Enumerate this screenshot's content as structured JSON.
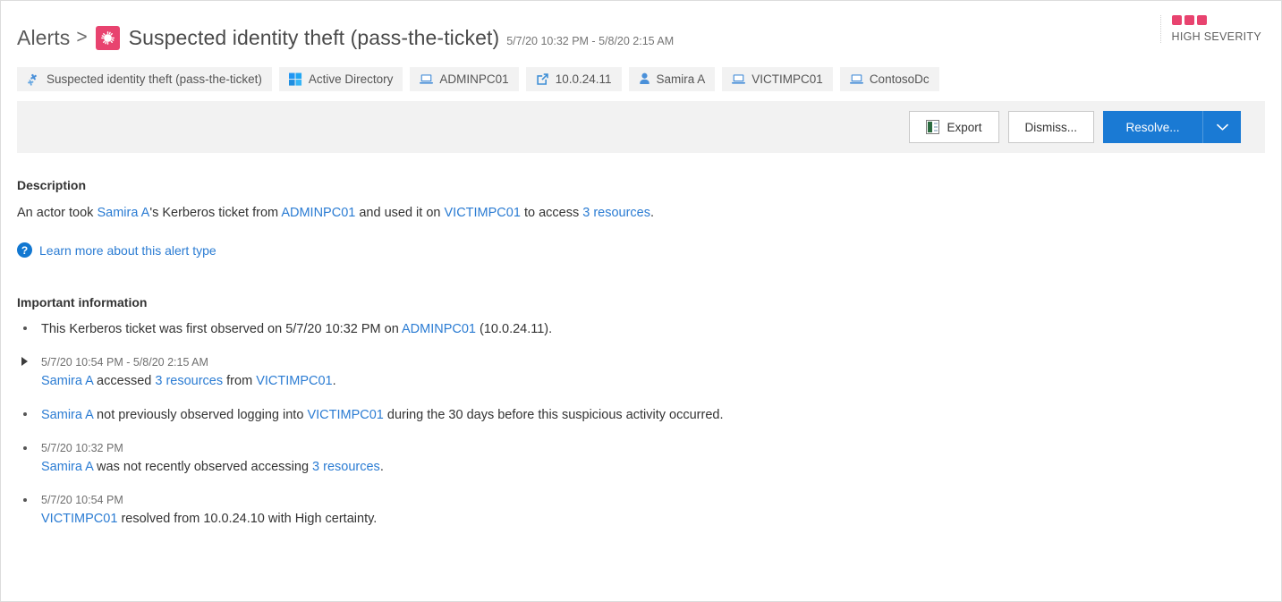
{
  "header": {
    "breadcrumb_root": "Alerts",
    "breadcrumb_separator": ">",
    "alert_icon": "alert-starburst-icon",
    "title": "Suspected identity theft (pass-the-ticket)",
    "time_range": "5/7/20 10:32 PM - 5/8/20 2:15 AM",
    "severity_label": "HIGH SEVERITY",
    "severity_color": "#e8436f",
    "severity_bars": 3
  },
  "chips": [
    {
      "label": "Suspected identity theft (pass-the-ticket)",
      "icon": "alert-puzzle-icon"
    },
    {
      "label": "Active Directory",
      "icon": "windows-logo-icon"
    },
    {
      "label": "ADMINPC01",
      "icon": "computer-icon"
    },
    {
      "label": "10.0.24.11",
      "icon": "external-link-icon"
    },
    {
      "label": "Samira A",
      "icon": "person-icon"
    },
    {
      "label": "VICTIMPC01",
      "icon": "computer-icon"
    },
    {
      "label": "ContosoDc",
      "icon": "computer-icon"
    }
  ],
  "toolbar": {
    "export_label": "Export",
    "export_icon": "excel-export-icon",
    "dismiss_label": "Dismiss...",
    "resolve_label": "Resolve...",
    "resolve_caret_icon": "chevron-down-icon",
    "primary_color": "#1a7ad4"
  },
  "description": {
    "heading": "Description",
    "parts": [
      {
        "text": "An actor took ",
        "link": false
      },
      {
        "text": "Samira A",
        "link": true
      },
      {
        "text": "'s Kerberos ticket from ",
        "link": false
      },
      {
        "text": "ADMINPC01",
        "link": true
      },
      {
        "text": " and used it on ",
        "link": false
      },
      {
        "text": "VICTIMPC01",
        "link": true
      },
      {
        "text": " to access ",
        "link": false
      },
      {
        "text": "3 resources",
        "link": true
      },
      {
        "text": ".",
        "link": false
      }
    ],
    "learn_more_label": "Learn more about this alert type",
    "learn_more_icon": "question-circle-icon"
  },
  "important_information": {
    "heading": "Important information",
    "items": [
      {
        "marker": "dot",
        "timestamp": "",
        "parts": [
          {
            "text": "This Kerberos ticket was first observed on 5/7/20 10:32 PM on ",
            "link": false
          },
          {
            "text": "ADMINPC01",
            "link": true
          },
          {
            "text": " (10.0.24.11).",
            "link": false
          }
        ]
      },
      {
        "marker": "triangle",
        "timestamp": "5/7/20 10:54 PM - 5/8/20 2:15 AM",
        "parts": [
          {
            "text": "Samira A",
            "link": true
          },
          {
            "text": " accessed ",
            "link": false
          },
          {
            "text": "3 resources",
            "link": true
          },
          {
            "text": " from ",
            "link": false
          },
          {
            "text": "VICTIMPC01",
            "link": true
          },
          {
            "text": ".",
            "link": false
          }
        ]
      },
      {
        "marker": "dot",
        "timestamp": "",
        "parts": [
          {
            "text": "Samira A",
            "link": true
          },
          {
            "text": " not previously observed logging into ",
            "link": false
          },
          {
            "text": "VICTIMPC01",
            "link": true
          },
          {
            "text": " during the 30 days before this suspicious activity occurred.",
            "link": false
          }
        ]
      },
      {
        "marker": "dot",
        "timestamp": "5/7/20 10:32 PM",
        "parts": [
          {
            "text": "Samira A",
            "link": true
          },
          {
            "text": " was not recently observed accessing ",
            "link": false
          },
          {
            "text": "3 resources",
            "link": true
          },
          {
            "text": ".",
            "link": false
          }
        ]
      },
      {
        "marker": "dot",
        "timestamp": "5/7/20 10:54 PM",
        "parts": [
          {
            "text": "VICTIMPC01",
            "link": true
          },
          {
            "text": " resolved from 10.0.24.10 with High certainty.",
            "link": false
          }
        ]
      }
    ]
  }
}
